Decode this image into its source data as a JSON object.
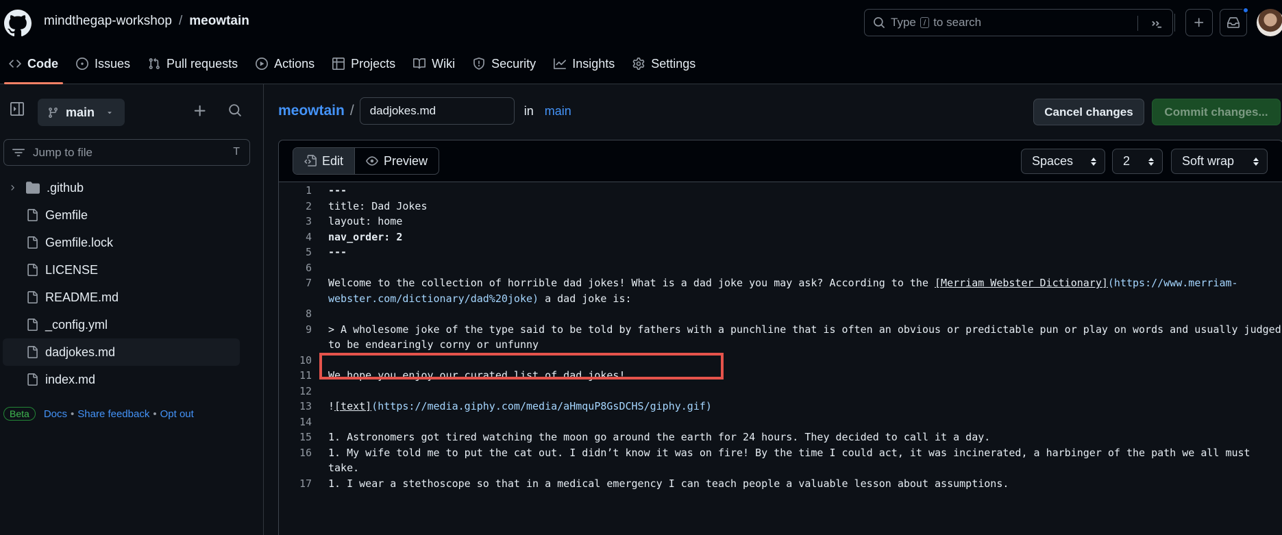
{
  "header": {
    "owner": "mindthegap-workshop",
    "separator": "/",
    "repo": "meowtain",
    "search_prefix": "Type",
    "search_key": "/",
    "search_suffix": "to search"
  },
  "repo_nav": [
    {
      "label": "Code",
      "icon": "code-icon",
      "active": true
    },
    {
      "label": "Issues",
      "icon": "issue-opened-icon"
    },
    {
      "label": "Pull requests",
      "icon": "git-pull-request-icon"
    },
    {
      "label": "Actions",
      "icon": "play-icon"
    },
    {
      "label": "Projects",
      "icon": "table-icon"
    },
    {
      "label": "Wiki",
      "icon": "book-icon"
    },
    {
      "label": "Security",
      "icon": "shield-icon"
    },
    {
      "label": "Insights",
      "icon": "graph-icon"
    },
    {
      "label": "Settings",
      "icon": "gear-icon"
    }
  ],
  "sidebar": {
    "branch": "main",
    "jump_placeholder": "Jump to file",
    "jump_shortcut": "T",
    "files": [
      {
        "name": ".github",
        "type": "folder"
      },
      {
        "name": "Gemfile",
        "type": "file"
      },
      {
        "name": "Gemfile.lock",
        "type": "file"
      },
      {
        "name": "LICENSE",
        "type": "file"
      },
      {
        "name": "README.md",
        "type": "file"
      },
      {
        "name": "_config.yml",
        "type": "file"
      },
      {
        "name": "dadjokes.md",
        "type": "file",
        "selected": true
      },
      {
        "name": "index.md",
        "type": "file"
      }
    ],
    "beta": {
      "badge": "Beta",
      "docs": "Docs",
      "feedback": "Share feedback",
      "opt_out": "Opt out",
      "dot": "•"
    }
  },
  "editor": {
    "crumb_repo": "meowtain",
    "crumb_sep": "/",
    "filename": "dadjokes.md",
    "in_label": "in",
    "branch": "main",
    "cancel_label": "Cancel changes",
    "commit_label": "Commit changes...",
    "edit_tab": "Edit",
    "preview_tab": "Preview",
    "indent_mode": "Spaces",
    "indent_size": "2",
    "wrap_mode": "Soft wrap"
  },
  "code_lines": [
    {
      "n": "1",
      "text": "---",
      "bold": true
    },
    {
      "n": "2",
      "text": "title: Dad Jokes"
    },
    {
      "n": "3",
      "text": "layout: home"
    },
    {
      "n": "4",
      "text": "nav_order: 2",
      "bold": true
    },
    {
      "n": "5",
      "text": "---",
      "bold": true
    },
    {
      "n": "6",
      "text": ""
    },
    {
      "n": "7",
      "pre": "Welcome to the collection of horrible dad jokes! What is a dad joke you may ask? According to the ",
      "link": "[Merriam Webster Dictionary]",
      "url": "(https://www.merriam-webster.com/dictionary/dad%20joke)",
      "post": " a dad joke is:"
    },
    {
      "n": "8",
      "text": ""
    },
    {
      "n": "9",
      "text": "> A wholesome joke of the type said to be told by fathers with a punchline that is often an obvious or predictable pun or play on words and usually judged to be endearingly corny or unfunny"
    },
    {
      "n": "10",
      "text": ""
    },
    {
      "n": "11",
      "text": "We hope you enjoy our curated list of dad jokes!"
    },
    {
      "n": "12",
      "text": ""
    },
    {
      "n": "13",
      "pre": "!",
      "link": "[text]",
      "url": "(https://media.giphy.com/media/aHmquP8GsDCHS/giphy.gif)",
      "post": ""
    },
    {
      "n": "14",
      "text": ""
    },
    {
      "n": "15",
      "text": "1. Astronomers got tired watching the moon go around the earth for 24 hours. They decided to call it a day."
    },
    {
      "n": "16",
      "text": "1. My wife told me to put the cat out. I didn’t know it was on fire! By the time I could act, it was incinerated, a harbinger of the path we all must take."
    },
    {
      "n": "17",
      "text": "1. I wear a stethoscope so that in a medical emergency I can teach people a valuable lesson about assumptions."
    }
  ],
  "colors": {
    "accent": "#4493f8",
    "active_underline": "#f78166",
    "highlight": "#e5534b",
    "commit_bg": "#1a4d26"
  }
}
